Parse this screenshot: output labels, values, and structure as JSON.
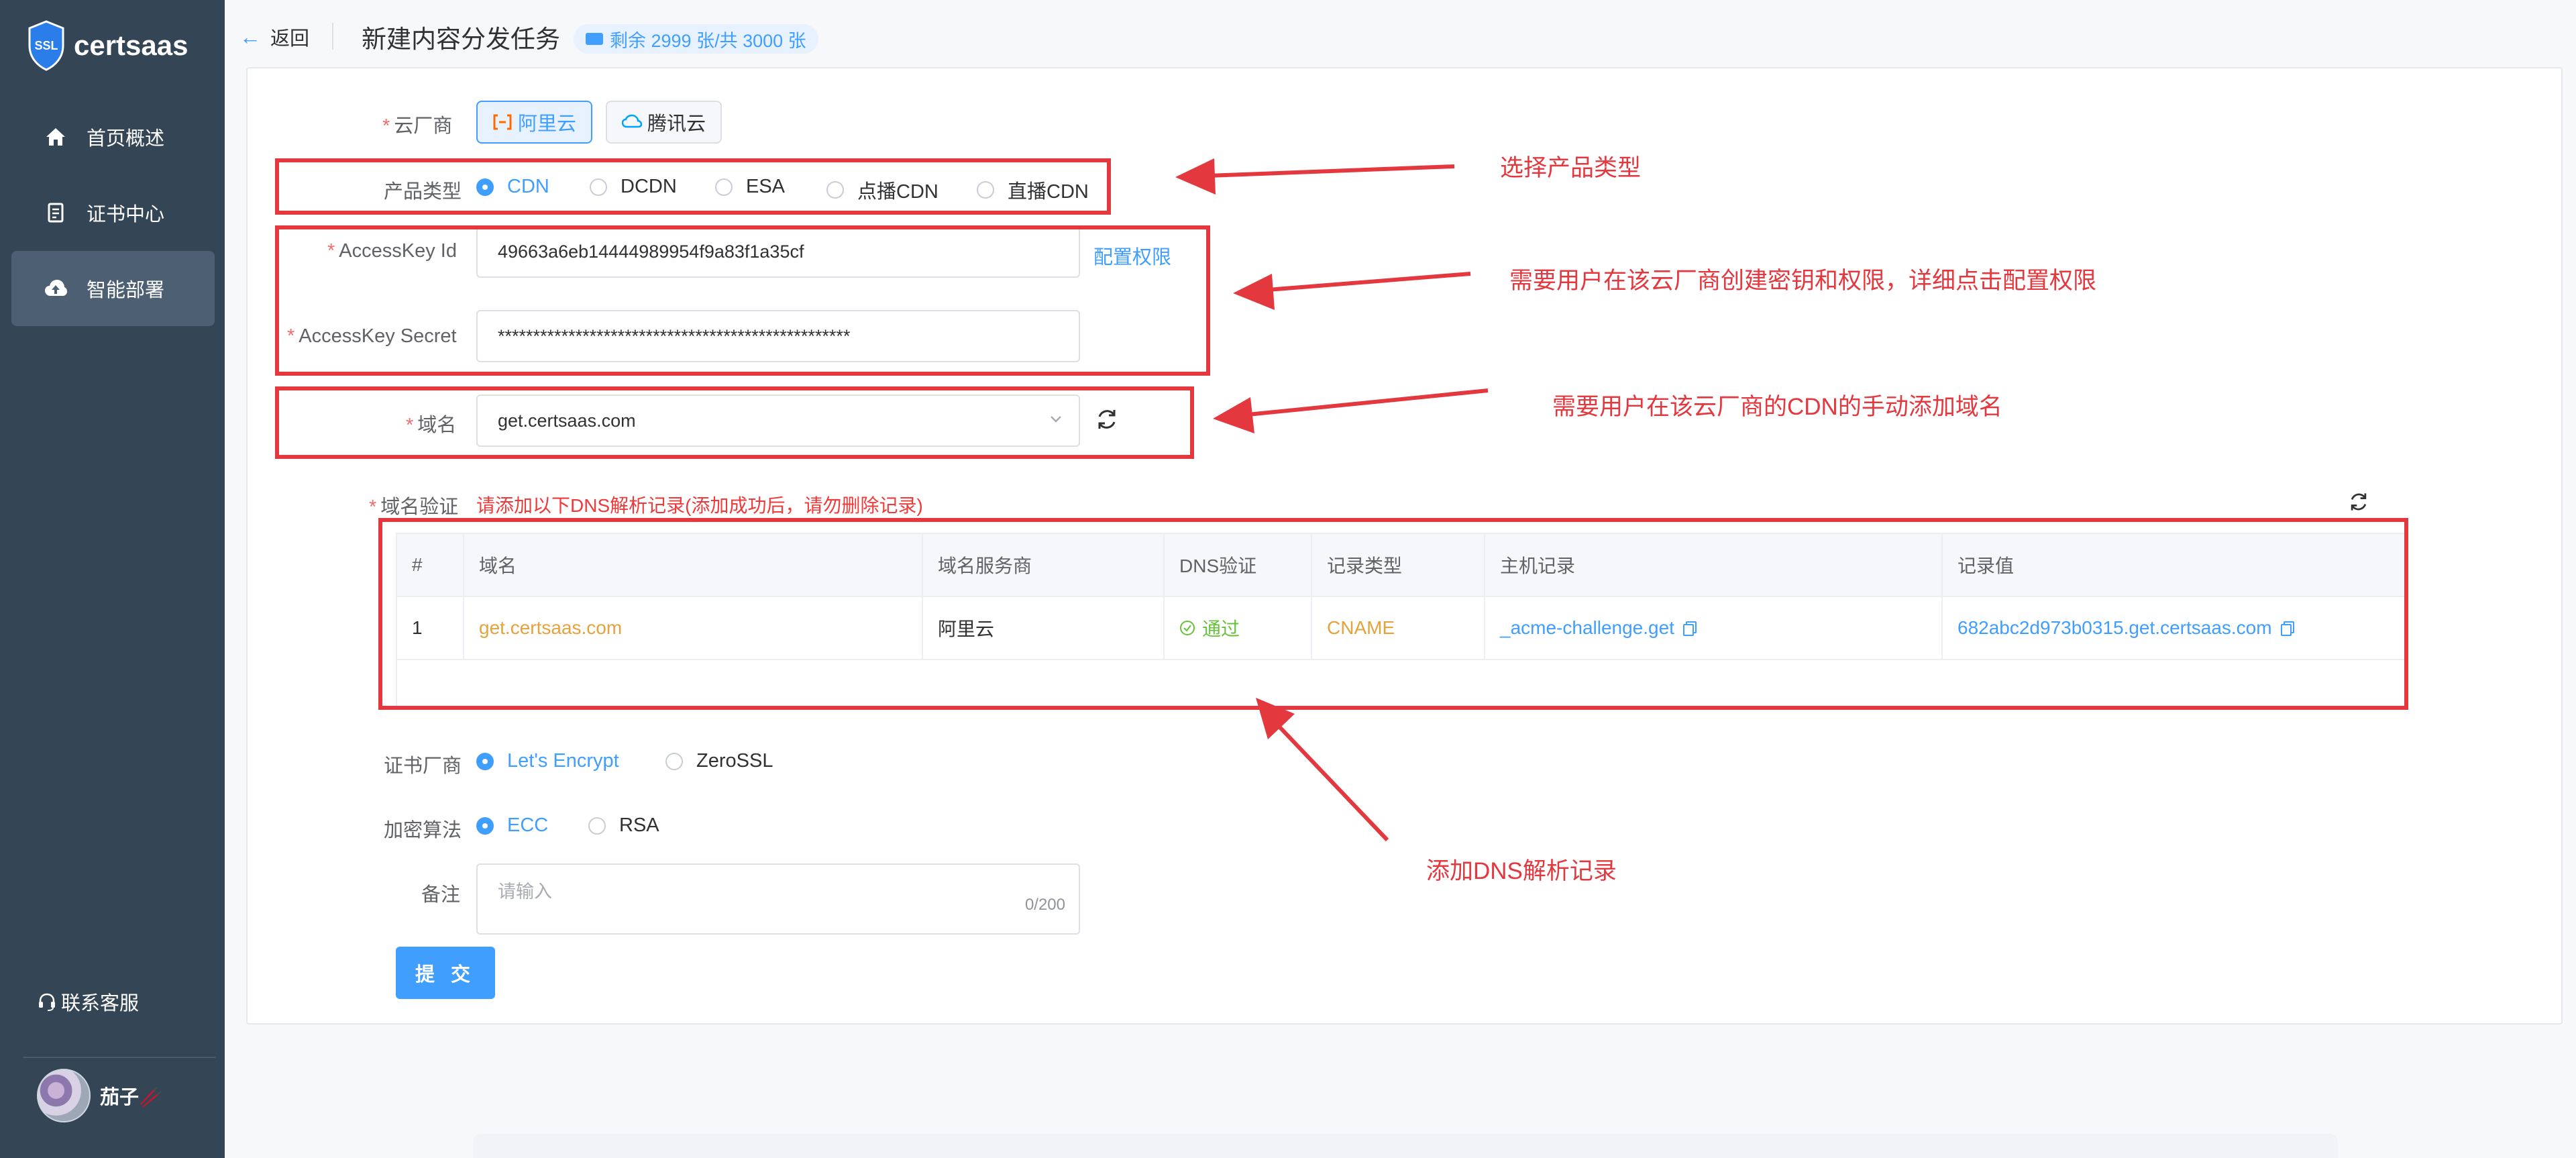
{
  "app": {
    "name": "certsaas",
    "logo_badge": "SSL"
  },
  "sidebar": {
    "items": [
      {
        "label": "首页概述",
        "icon": "home-icon"
      },
      {
        "label": "证书中心",
        "icon": "document-icon"
      },
      {
        "label": "智能部署",
        "icon": "cloud-upload-icon",
        "active": true
      }
    ],
    "support_label": "联系客服",
    "user_name": "茄子🥢"
  },
  "header": {
    "back_label": "返回",
    "title": "新建内容分发任务",
    "quota": "剩余 2999 张/共 3000 张"
  },
  "form": {
    "cloud_vendor": {
      "label": "云厂商",
      "options": [
        "阿里云",
        "腾讯云"
      ],
      "selected": "阿里云"
    },
    "product_type": {
      "label": "产品类型",
      "options": [
        "CDN",
        "DCDN",
        "ESA",
        "点播CDN",
        "直播CDN"
      ],
      "selected": "CDN"
    },
    "access_key_id": {
      "label": "AccessKey Id",
      "value": "49663a6eb14444989954f9a83f1a35cf",
      "link": "配置权限"
    },
    "access_key_secret": {
      "label": "AccessKey Secret",
      "value": "**************************************************"
    },
    "domain": {
      "label": "域名",
      "value": "get.certsaas.com"
    },
    "domain_verify": {
      "label": "域名验证",
      "note": "请添加以下DNS解析记录(添加成功后，请勿删除记录)",
      "columns": [
        "#",
        "域名",
        "域名服务商",
        "DNS验证",
        "记录类型",
        "主机记录",
        "记录值"
      ],
      "rows": [
        {
          "index": "1",
          "domain": "get.certsaas.com",
          "provider": "阿里云",
          "dns_status": "通过",
          "record_type": "CNAME",
          "host": "_acme-challenge.get",
          "value": "682abc2d973b0315.get.certsaas.com"
        }
      ]
    },
    "cert_vendor": {
      "label": "证书厂商",
      "options": [
        "Let's Encrypt",
        "ZeroSSL"
      ],
      "selected": "Let's Encrypt"
    },
    "algorithm": {
      "label": "加密算法",
      "options": [
        "ECC",
        "RSA"
      ],
      "selected": "ECC"
    },
    "remark": {
      "label": "备注",
      "placeholder": "请输入",
      "counter": "0/200"
    },
    "submit_label": "提 交"
  },
  "annotations": {
    "product_type": "选择产品类型",
    "access_key": "需要用户在该云厂商创建密钥和权限，详细点击配置权限",
    "domain": "需要用户在该云厂商的CDN的手动添加域名",
    "dns": "添加DNS解析记录"
  },
  "colors": {
    "primary": "#409eff",
    "sidebar": "#344555",
    "annotation": "#e4383f",
    "success": "#67c23a",
    "warning": "#e6a23c"
  }
}
